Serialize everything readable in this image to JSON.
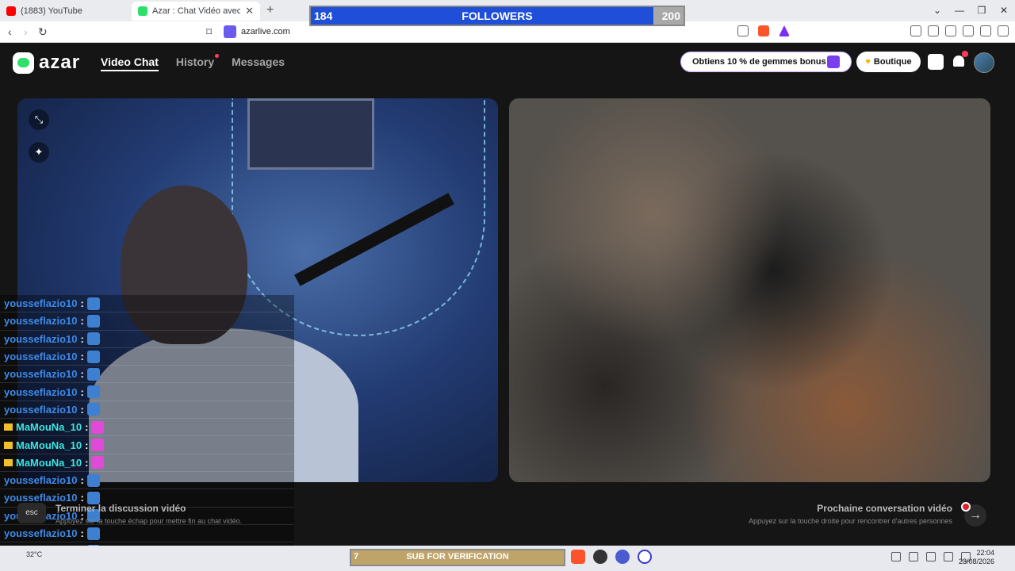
{
  "browser": {
    "tabs": [
      {
        "title": "(1883) YouTube",
        "favicon_color": "#ff0000"
      },
      {
        "title": "Azar : Chat Vidéo avec de nou",
        "favicon_color": "#2ce06a"
      }
    ],
    "url": "azarlive.com"
  },
  "followers_goal": {
    "current": "184",
    "label": "FOLLOWERS",
    "goal": "200",
    "progress_fraction": 0.92
  },
  "app": {
    "logo": "azar",
    "nav": {
      "video_chat": "Video Chat",
      "history": "History",
      "messages": "Messages"
    },
    "promo": "Obtiens 10 % de gemmes bonus !",
    "shop": "Boutique"
  },
  "chat": [
    {
      "name": "yousseflazio10",
      "sep": ":",
      "style": "blue",
      "emote": "pc"
    },
    {
      "name": "yousseflazio10",
      "sep": ":",
      "style": "blue",
      "emote": "pc"
    },
    {
      "name": "yousseflazio10",
      "sep": ":",
      "style": "blue",
      "emote": "pc"
    },
    {
      "name": "yousseflazio10",
      "sep": ":",
      "style": "blue",
      "emote": "pc"
    },
    {
      "name": "yousseflazio10",
      "sep": ":",
      "style": "blue",
      "emote": "pc"
    },
    {
      "name": "yousseflazio10",
      "sep": ":",
      "style": "blue",
      "emote": "pc"
    },
    {
      "name": "yousseflazio10",
      "sep": ":",
      "style": "blue",
      "emote": "pc"
    },
    {
      "name": "MaMouNa_10",
      "sep": ":",
      "style": "cyan",
      "emote": "pk"
    },
    {
      "name": "MaMouNa_10",
      "sep": ":",
      "style": "cyan",
      "emote": "pk"
    },
    {
      "name": "MaMouNa_10",
      "sep": ":",
      "style": "cyan",
      "emote": "pk"
    },
    {
      "name": "yousseflazio10",
      "sep": ":",
      "style": "blue",
      "emote": "pc"
    },
    {
      "name": "yousseflazio10",
      "sep": ":",
      "style": "blue",
      "emote": "pc"
    },
    {
      "name": "yousseflazio10",
      "sep": ":",
      "style": "blue",
      "emote": "pc"
    },
    {
      "name": "yousseflazio10",
      "sep": ":",
      "style": "blue",
      "emote": "pc"
    },
    {
      "name": "yousseflazio10",
      "sep": ":",
      "style": "blue",
      "emote": "pc"
    }
  ],
  "hints": {
    "esc_key": "esc",
    "end_title": "Terminer la discussion vidéo",
    "end_sub": "Appuyez sur la touche échap pour mettre fin au chat vidéo.",
    "next_title": "Prochaine conversation vidéo",
    "next_sub": "Appuyez sur la touche droite pour rencontrer d'autres personnes"
  },
  "taskbar": {
    "temperature": "32°C",
    "sub_count": "7",
    "sub_label": "SUB FOR VERIFICATION",
    "time": "22:04",
    "date": "23/08/2026"
  }
}
